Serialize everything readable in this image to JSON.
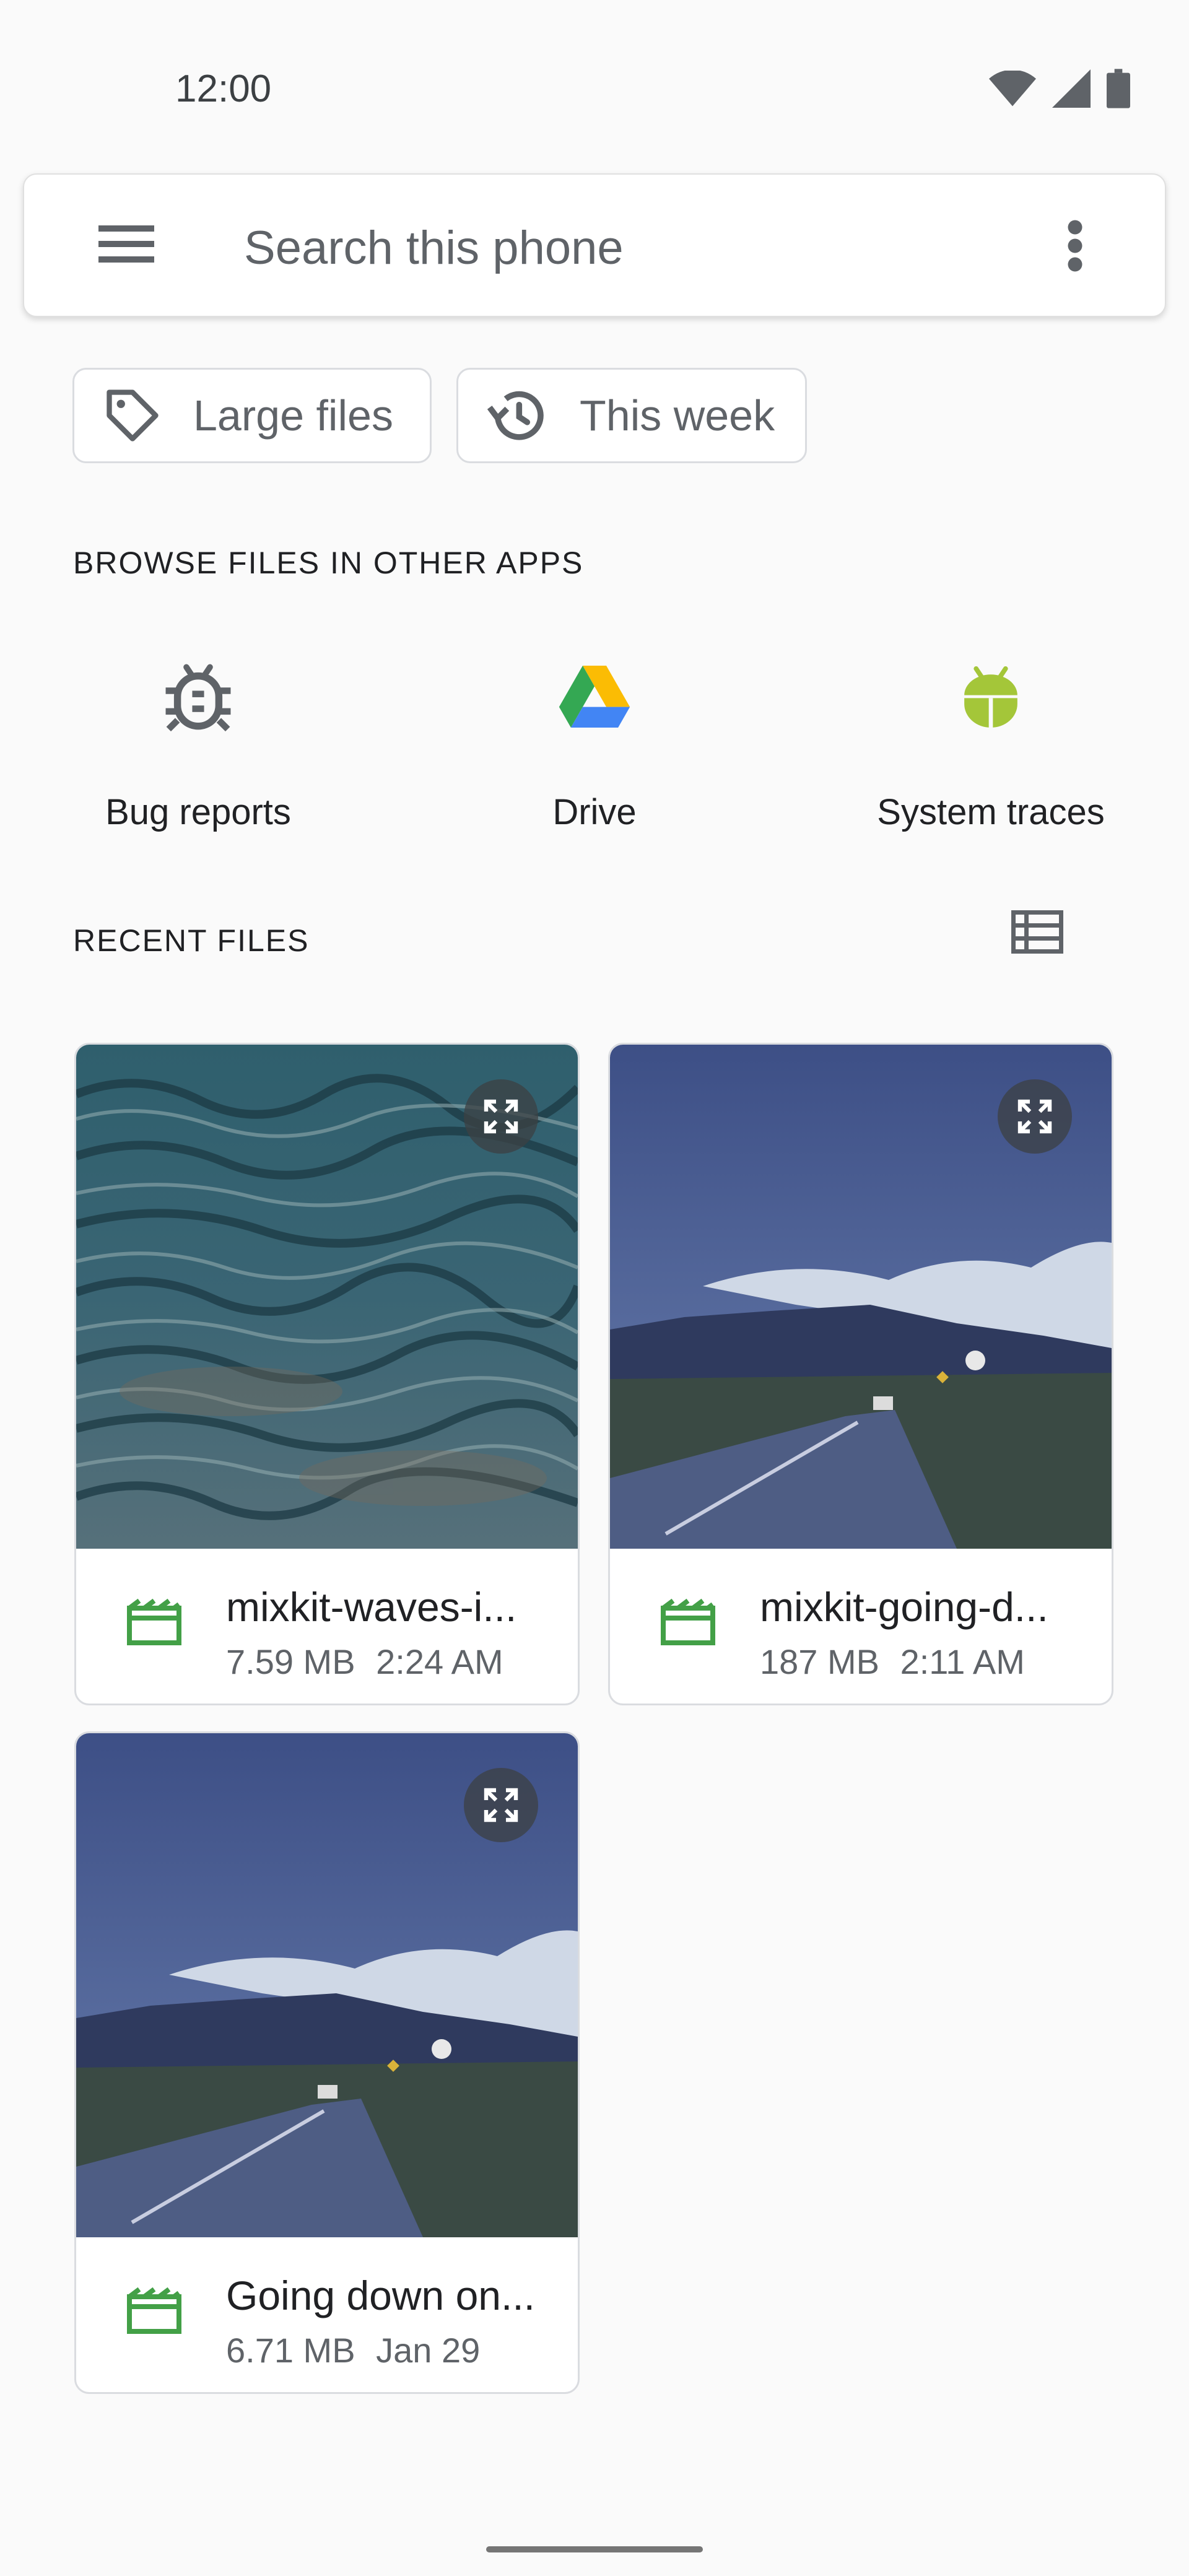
{
  "status_bar": {
    "time": "12:00",
    "icons": [
      "wifi-icon",
      "signal-icon",
      "battery-icon"
    ]
  },
  "search": {
    "placeholder": "Search this phone",
    "menu_icon": "menu-icon",
    "overflow_icon": "more-vert-icon"
  },
  "chips": [
    {
      "label": "Large files",
      "icon": "label-tag-icon"
    },
    {
      "label": "This week",
      "icon": "history-icon"
    }
  ],
  "browse": {
    "header": "BROWSE FILES IN OTHER APPS",
    "apps": [
      {
        "label": "Bug reports",
        "icon": "bug-icon"
      },
      {
        "label": "Drive",
        "icon": "drive-icon"
      },
      {
        "label": "System traces",
        "icon": "android-icon"
      }
    ]
  },
  "recent": {
    "header": "RECENT FILES",
    "view_toggle_icon": "list-view-icon",
    "files": [
      {
        "name": "mixkit-waves-i...",
        "size": "7.59 MB",
        "date": "2:24 AM",
        "thumbnail": "ocean-waves"
      },
      {
        "name": "mixkit-going-d...",
        "size": "187 MB",
        "date": "2:11 AM",
        "thumbnail": "mountain-road"
      },
      {
        "name": "Going down on...",
        "size": "6.71 MB",
        "date": "Jan 29",
        "thumbnail": "mountain-road"
      }
    ]
  },
  "colors": {
    "accent_green": "#43a047",
    "android_green": "#a4c639",
    "text_primary": "#202124",
    "text_secondary": "#5f6368"
  }
}
